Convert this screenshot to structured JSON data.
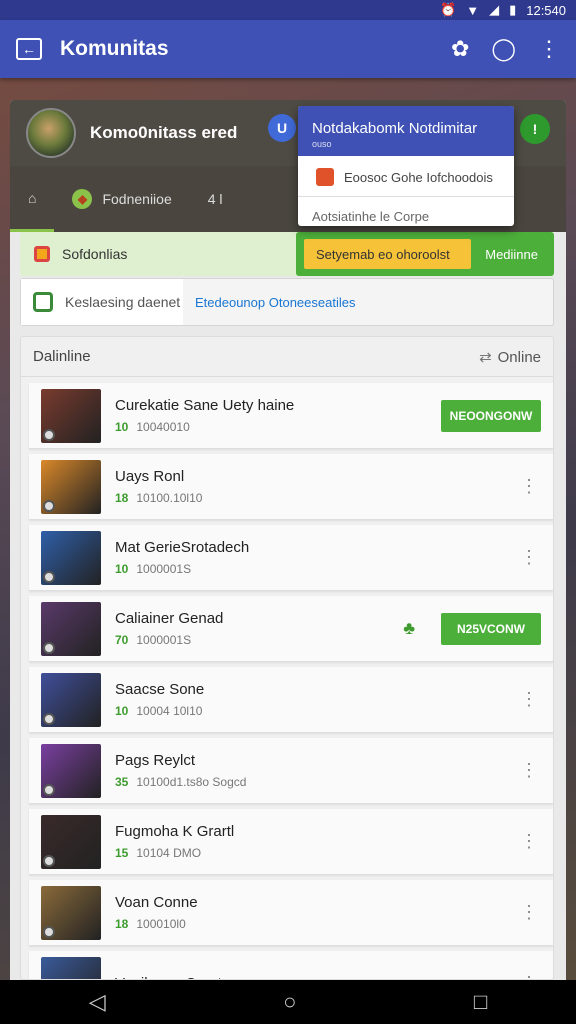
{
  "status_bar": {
    "time": "12:540"
  },
  "app_bar": {
    "title": "Komunitas"
  },
  "profile": {
    "name": "Komo0nitass ered"
  },
  "popup": {
    "title": "Notdakabomk Notdimitar",
    "subtitle": "ouso",
    "item1": "Eoosoc Gohe Iofchoodois",
    "item2": "Aotsiatinhe le Corpe"
  },
  "tabs": [
    {
      "label": "Fodneniioe"
    },
    {
      "label": "4 l"
    }
  ],
  "solution_row": {
    "label": "Sofdonlias",
    "yellow_button": "Setyemab eo ohoroolst",
    "green_button": "Mediinne"
  },
  "search_row": {
    "left_text": "Keslaesing daenet",
    "right_text": "Etedeounop Otoneeseatiles"
  },
  "list": {
    "header_left": "Dalinline",
    "header_right": "Online",
    "items": [
      {
        "title": "Curekatie Sane Uety haine",
        "score": "10",
        "meta": "10040010",
        "button": "NEOONGONW"
      },
      {
        "title": "Uays Ronl",
        "score": "18",
        "meta": "10100.10l10",
        "button": ""
      },
      {
        "title": "Mat GerieSrotadech",
        "score": "10",
        "meta": "1000001S",
        "button": ""
      },
      {
        "title": "Caliainer Genad",
        "score": "70",
        "meta": "1000001S",
        "button": "N25VCONW"
      },
      {
        "title": "Saacse Sone",
        "score": "10",
        "meta": "10004 10l10",
        "button": ""
      },
      {
        "title": "Pags Reylct",
        "score": "35",
        "meta": "10100d1.ts8o Sogcd",
        "button": ""
      },
      {
        "title": "Fugmoha K Grartl",
        "score": "15",
        "meta": "10104 DMO",
        "button": ""
      },
      {
        "title": "Voan Conne",
        "score": "18",
        "meta": "100010l0",
        "button": ""
      },
      {
        "title": "Veailanen Cornt",
        "score": "",
        "meta": "",
        "button": ""
      }
    ]
  },
  "thumb_colors": [
    "#7a3b2e",
    "#d9882a",
    "#2f5fa8",
    "#5a3a6a",
    "#3f4f9a",
    "#7a3fa0",
    "#3a2a2a",
    "#8a6a3a",
    "#3a5a9a"
  ],
  "colors": {
    "accent": "#3f51b5",
    "green": "#4caf3a",
    "yellow": "#f6c238"
  }
}
